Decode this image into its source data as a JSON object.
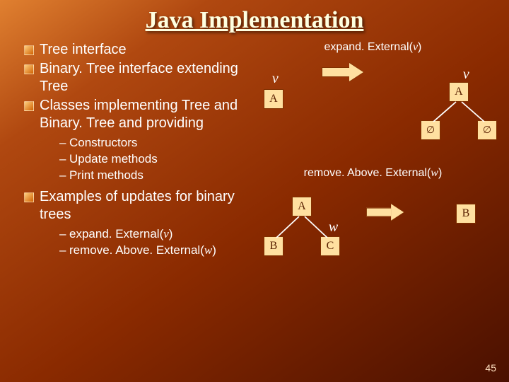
{
  "title": "Java Implementation",
  "bullets": {
    "b1": "Tree interface",
    "b2": "Binary. Tree interface extending Tree",
    "b3": "Classes implementing Tree and Binary. Tree and providing",
    "b3sub": {
      "s1": "Constructors",
      "s2": "Update methods",
      "s3": "Print methods"
    },
    "b4": "Examples of updates for binary trees",
    "b4sub": {
      "s1a": "expand. External(",
      "s1b": "v",
      "s1c": ")",
      "s2a": "remove. Above. External(",
      "s2b": "w",
      "s2c": ")"
    }
  },
  "panel1": {
    "caption_a": "expand. External(",
    "caption_b": "v",
    "caption_c": ")",
    "left_v": "v",
    "left_A": "A",
    "right_v": "v",
    "right_A": "A"
  },
  "panel2": {
    "caption_a": "remove. Above. External(",
    "caption_b": "w",
    "caption_c": ")",
    "root_A": "A",
    "left_B": "B",
    "left_C": "C",
    "w": "w",
    "right_B": "B"
  },
  "pageno": "45"
}
